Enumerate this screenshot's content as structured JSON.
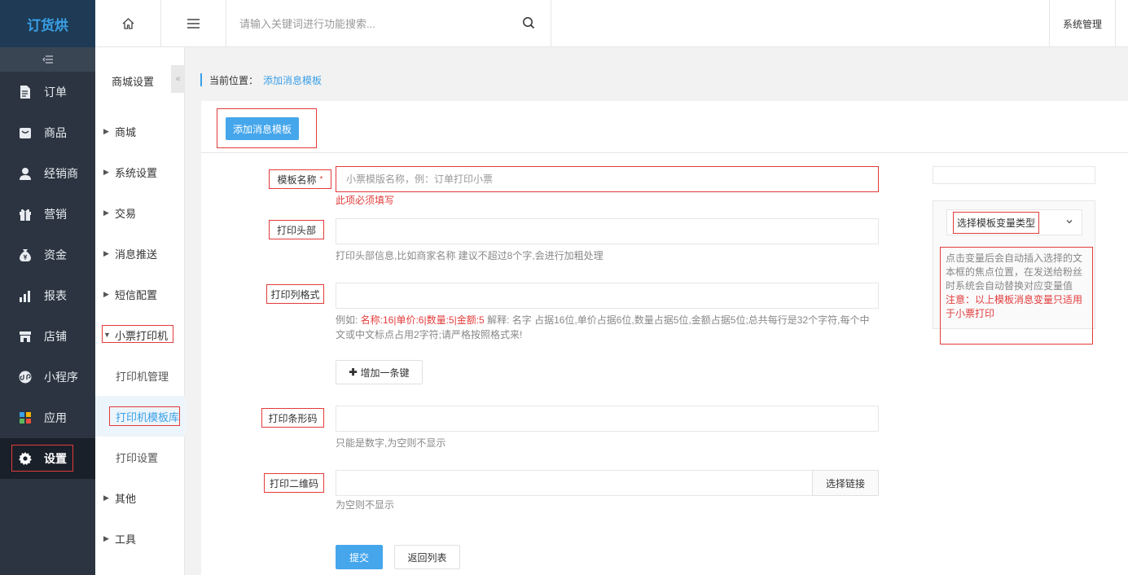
{
  "app": {
    "logo": "订货烘"
  },
  "sidebar": {
    "items": [
      {
        "label": "订单",
        "icon": "document-icon"
      },
      {
        "label": "商品",
        "icon": "product-icon"
      },
      {
        "label": "经销商",
        "icon": "user-icon"
      },
      {
        "label": "营销",
        "icon": "gift-icon"
      },
      {
        "label": "资金",
        "icon": "money-bag-icon"
      },
      {
        "label": "报表",
        "icon": "bar-chart-icon"
      },
      {
        "label": "店铺",
        "icon": "shop-icon"
      },
      {
        "label": "小程序",
        "icon": "mini-program-icon"
      },
      {
        "label": "应用",
        "icon": "apps-icon"
      },
      {
        "label": "设置",
        "icon": "gear-icon"
      }
    ]
  },
  "header": {
    "search_placeholder": "请输入关键词进行功能搜索...",
    "system_management": "系统管理"
  },
  "submenu": {
    "title": "商城设置",
    "items": [
      {
        "label": "商城"
      },
      {
        "label": "系统设置"
      },
      {
        "label": "交易"
      },
      {
        "label": "消息推送"
      },
      {
        "label": "短信配置"
      },
      {
        "label": "小票打印机"
      },
      {
        "label": "打印机管理"
      },
      {
        "label": "打印机模板库"
      },
      {
        "label": "打印设置"
      },
      {
        "label": "其他"
      },
      {
        "label": "工具"
      }
    ]
  },
  "breadcrumb": {
    "prefix": "当前位置：",
    "current": "添加消息模板"
  },
  "tab": {
    "add_button": "添加消息模板"
  },
  "form": {
    "template_name": {
      "label": "模板名称",
      "required": "*",
      "placeholder": "小票模版名称，例：订单打印小票",
      "error": "此项必须填写"
    },
    "print_header": {
      "label": "打印头部",
      "help": "打印头部信息,比如商家名称 建议不超过8个字,会进行加粗处理"
    },
    "print_columns": {
      "label": "打印列格式",
      "help_prefix": "例如: ",
      "help_example": "名称:16|单价:6|数量:5|金额:5",
      "help_rest": " 解释: 名字 占据16位,单价占据6位,数量占据5位,金额占据5位;总共每行是32个字符,每个中文或中文标点占用2字符;请严格按照格式来!",
      "add_key_button": "增加一条键"
    },
    "print_barcode": {
      "label": "打印条形码",
      "help": "只能是数字,为空则不显示"
    },
    "print_qrcode": {
      "label": "打印二维码",
      "select_link_button": "选择链接",
      "help": "为空则不显示"
    },
    "submit_button": "提交",
    "back_button": "返回列表"
  },
  "variable_panel": {
    "select_label": "选择模板变量类型",
    "hint": "点击变量后会自动插入选择的文本框的焦点位置，在发送给粉丝时系统会自动替换对应变量值",
    "note": "注意：以上模板消息变量只适用于小票打印"
  },
  "colors": {
    "accent": "#3aa0e6",
    "error": "#e23b3b",
    "sidebar": "#2b3440"
  }
}
